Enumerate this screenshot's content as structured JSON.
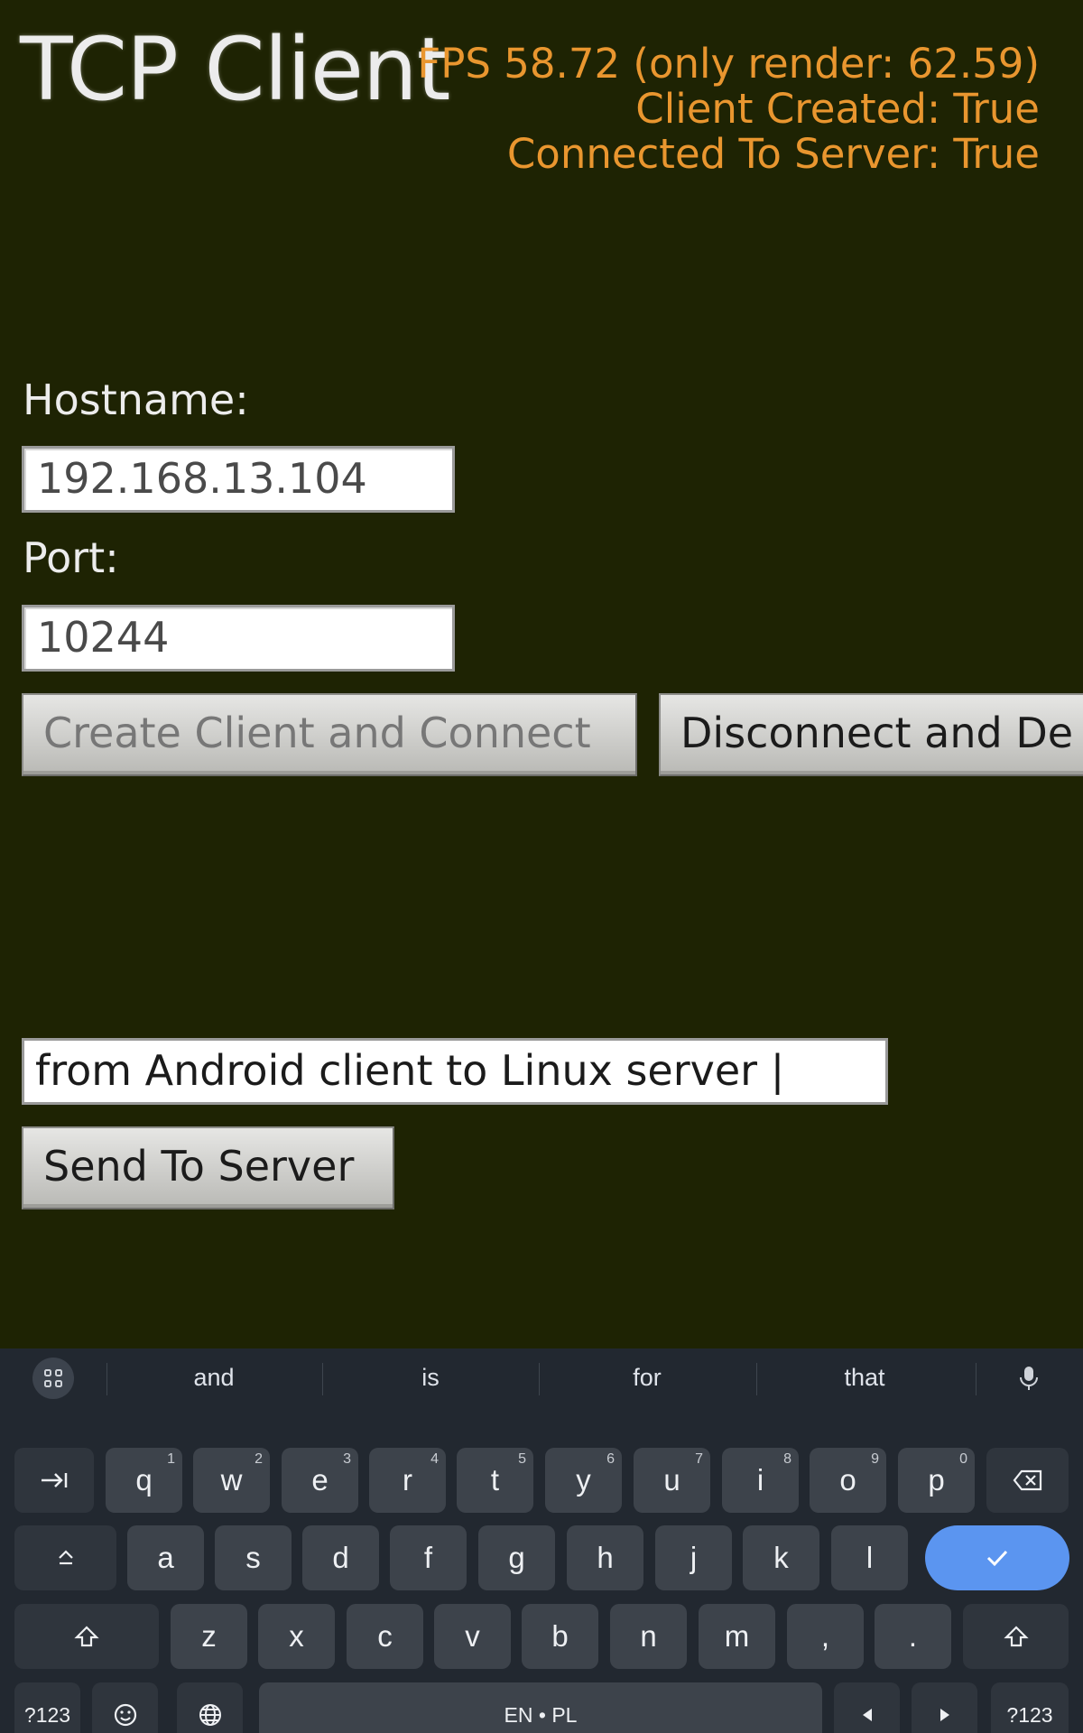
{
  "app": {
    "title": "TCP Client",
    "status": {
      "fps": "FPS 58.72 (only render: 62.59)",
      "client_created": "Client Created: True",
      "connected": "Connected To Server: True"
    },
    "hostname": {
      "label": "Hostname:",
      "value": "192.168.13.104"
    },
    "port": {
      "label": "Port:",
      "value": "10244"
    },
    "buttons": {
      "create_connect": "Create Client and Connect",
      "disconnect": "Disconnect and De"
    },
    "message": {
      "value": "from Android client to Linux server |"
    },
    "send_button": "Send To Server",
    "colors": {
      "background": "#1e2303",
      "status_text": "#e9962f"
    }
  },
  "keyboard": {
    "suggestions": [
      "and",
      "is",
      "for",
      "that"
    ],
    "rows": {
      "row1": [
        {
          "label": "q",
          "hint": "1"
        },
        {
          "label": "w",
          "hint": "2"
        },
        {
          "label": "e",
          "hint": "3"
        },
        {
          "label": "r",
          "hint": "4"
        },
        {
          "label": "t",
          "hint": "5"
        },
        {
          "label": "y",
          "hint": "6"
        },
        {
          "label": "u",
          "hint": "7"
        },
        {
          "label": "i",
          "hint": "8"
        },
        {
          "label": "o",
          "hint": "9"
        },
        {
          "label": "p",
          "hint": "0"
        }
      ],
      "row2": [
        "a",
        "s",
        "d",
        "f",
        "g",
        "h",
        "j",
        "k",
        "l"
      ],
      "row3": [
        "z",
        "x",
        "c",
        "v",
        "b",
        "n",
        "m",
        ",",
        "."
      ]
    },
    "symbols_label": "?123",
    "space_label": "EN • PL",
    "icons": [
      "apps-icon",
      "mic-icon",
      "tab-icon",
      "backspace-icon",
      "caps-lock-icon",
      "enter-check-icon",
      "shift-icon",
      "emoji-icon",
      "globe-icon",
      "arrow-left-icon",
      "arrow-right-icon"
    ],
    "colors": {
      "background": "#222830",
      "key": "#3d434b",
      "enter": "#5b95f0"
    }
  }
}
